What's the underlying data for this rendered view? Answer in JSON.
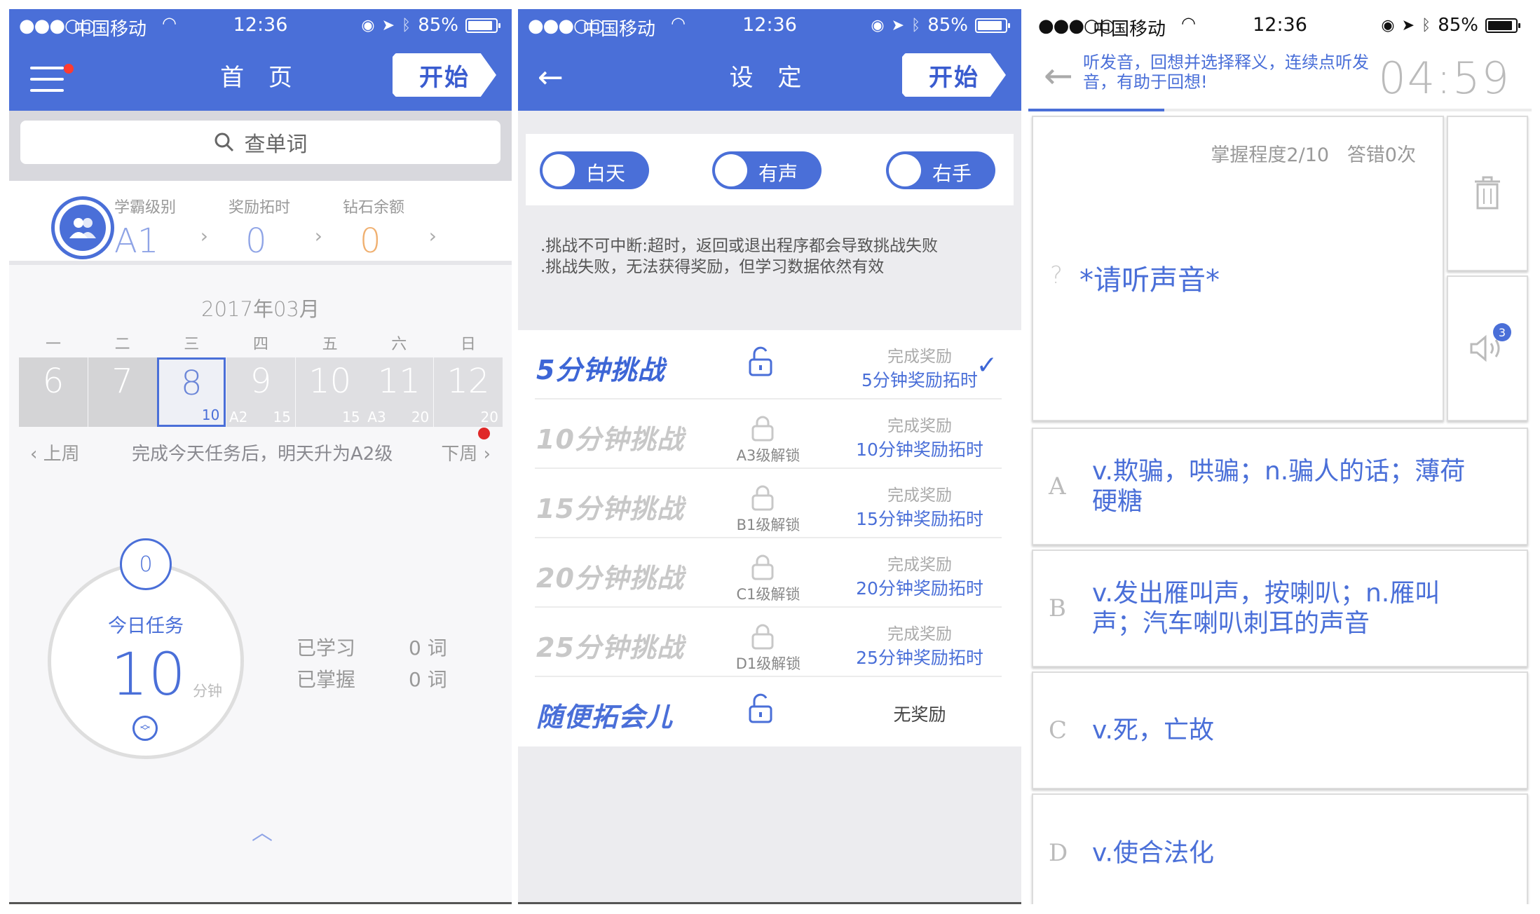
{
  "colors": {
    "accent": "#4a6fd8",
    "alert": "#e02828"
  },
  "status_bar": {
    "carrier": "中国移动",
    "time": "12:36",
    "battery": "85%",
    "battery_level": 0.85
  },
  "home": {
    "title": "首 页",
    "start_label": "开始",
    "search_placeholder": "查单词",
    "stats": [
      {
        "label": "学霸级别",
        "value": "A1"
      },
      {
        "label": "奖励拓时",
        "value": "0"
      },
      {
        "label": "钻石余额",
        "value": "0"
      }
    ],
    "month": "2017年03月",
    "weekdays": [
      "一",
      "二",
      "三",
      "四",
      "五",
      "六",
      "日"
    ],
    "days": [
      {
        "num": "6",
        "level": "",
        "target": ""
      },
      {
        "num": "7",
        "level": "",
        "target": ""
      },
      {
        "num": "8",
        "level": "",
        "target": "10"
      },
      {
        "num": "9",
        "level": "A2",
        "target": "15"
      },
      {
        "num": "10",
        "level": "",
        "target": "15"
      },
      {
        "num": "11",
        "level": "A3",
        "target": "20"
      },
      {
        "num": "12",
        "level": "",
        "target": "20"
      }
    ],
    "prev_week": "上周",
    "next_week": "下周",
    "calendar_message": "完成今天任务后，明天升为A2级",
    "ring_top_value": "0",
    "task_title": "今日任务",
    "task_minutes": "10",
    "task_unit": "分钟",
    "learned_label": "已学习",
    "learned_value": "0 词",
    "mastered_label": "已掌握",
    "mastered_value": "0 词"
  },
  "settings": {
    "title": "设 定",
    "start_label": "开始",
    "toggles": [
      "白天",
      "有声",
      "右手"
    ],
    "notes": [
      ".挑战不可中断:超时，返回或退出程序都会导致挑战失败",
      ".挑战失败，无法获得奖励，但学习数据依然有效"
    ],
    "challenges": [
      {
        "name": "5分钟挑战",
        "unlock": "",
        "reward_title": "完成奖励",
        "reward": "5分钟奖励拓时"
      },
      {
        "name": "10分钟挑战",
        "unlock": "A3级解锁",
        "reward_title": "完成奖励",
        "reward": "10分钟奖励拓时"
      },
      {
        "name": "15分钟挑战",
        "unlock": "B1级解锁",
        "reward_title": "完成奖励",
        "reward": "15分钟奖励拓时"
      },
      {
        "name": "20分钟挑战",
        "unlock": "C1级解锁",
        "reward_title": "完成奖励",
        "reward": "20分钟奖励拓时"
      },
      {
        "name": "25分钟挑战",
        "unlock": "D1级解锁",
        "reward_title": "完成奖励",
        "reward": "25分钟奖励拓时"
      },
      {
        "name": "随便拓会儿",
        "unlock": "",
        "reward_title": "",
        "reward": "无奖励"
      }
    ]
  },
  "quiz": {
    "hint": "听发音，回想并选择释义，连续点听发音，有助于回想!",
    "timer": "04:59",
    "progress": 0.27,
    "mastery": "掌握程度2/10",
    "wrong": "答错0次",
    "question_mark": "?",
    "prompt": "*请听声音*",
    "audio_badge": "3",
    "options": [
      {
        "letter": "A",
        "text": "v.欺骗，哄骗；n.骗人的话；薄荷硬糖"
      },
      {
        "letter": "B",
        "text": "v.发出雁叫声，按喇叭；n.雁叫声；汽车喇叭刺耳的声音"
      },
      {
        "letter": "C",
        "text": "v.死，亡故"
      },
      {
        "letter": "D",
        "text": "v.使合法化"
      }
    ]
  }
}
